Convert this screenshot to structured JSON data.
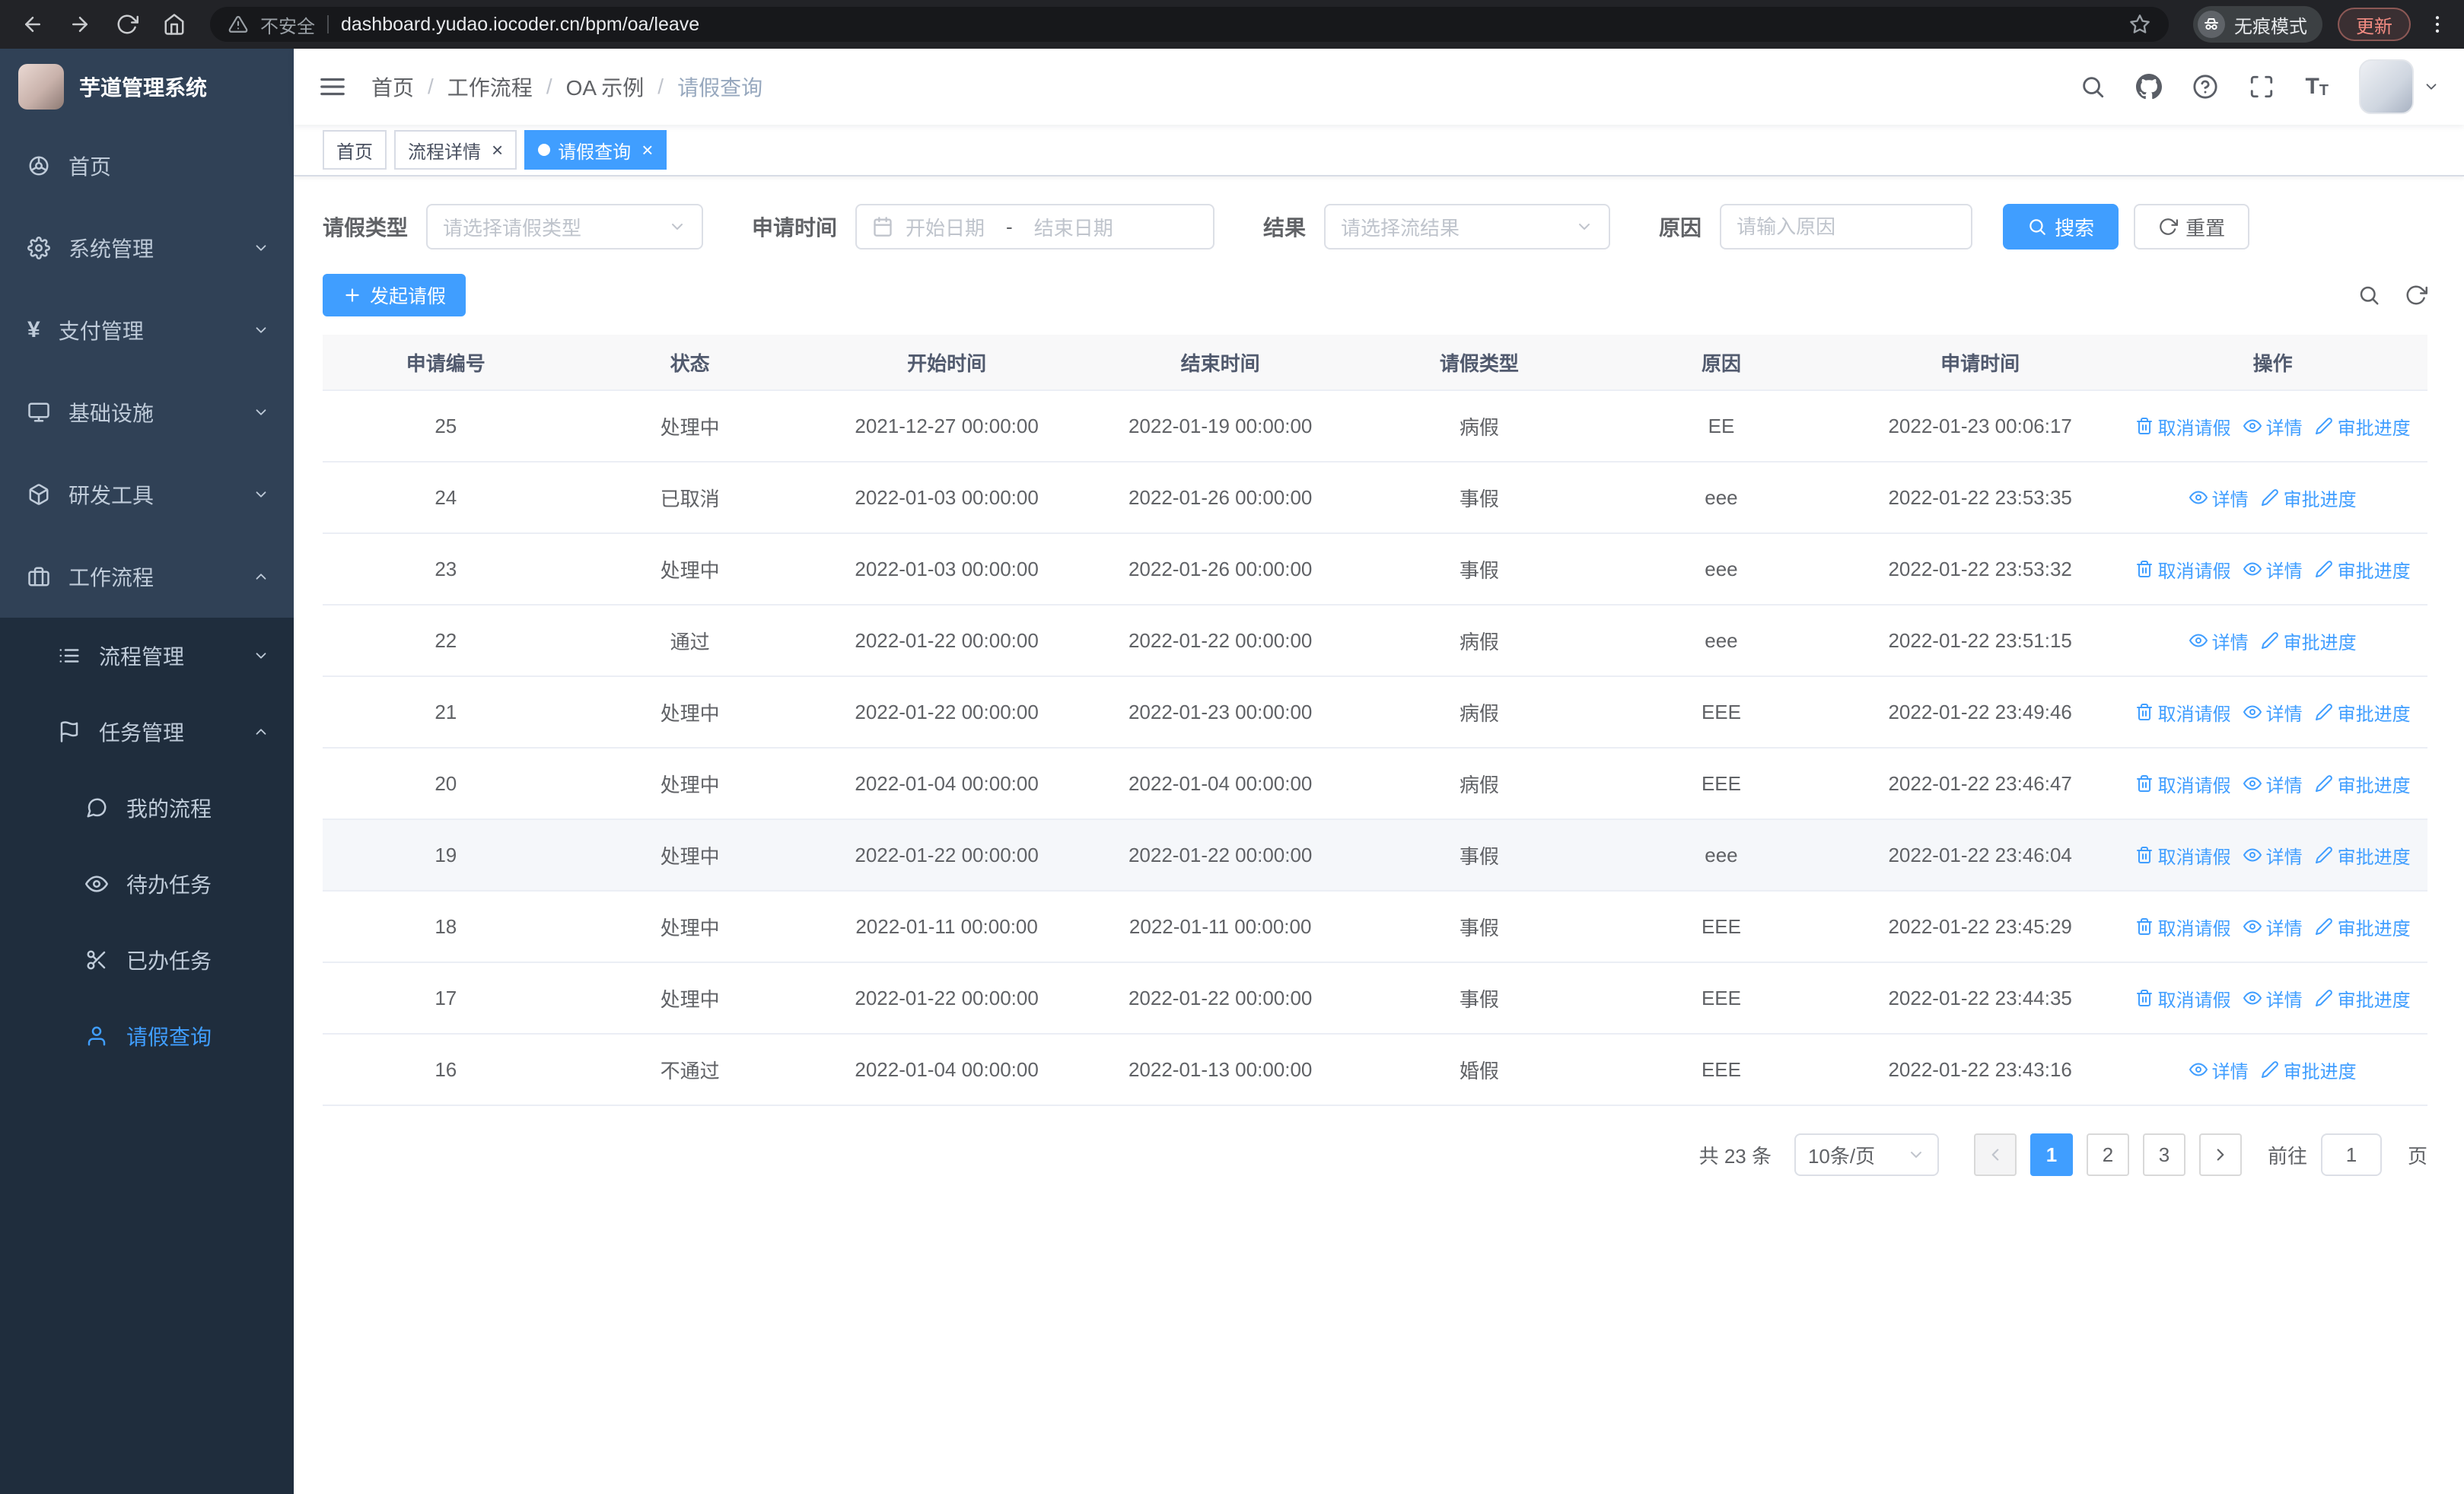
{
  "colors": {
    "primary": "#409eff",
    "sidebar_bg": "#304156",
    "submenu_bg": "#1f2d3d",
    "chrome_bg": "#222327",
    "update_badge": "#f28b82"
  },
  "browser": {
    "nav_icons": [
      "back-icon",
      "forward-icon",
      "refresh-icon",
      "home-icon"
    ],
    "security_label": "不安全",
    "url": "dashboard.yudao.iocoder.cn/bpm/oa/leave",
    "incognito_label": "无痕模式",
    "update_label": "更新"
  },
  "sidebar": {
    "logo_title": "芋道管理系统",
    "items": [
      {
        "name": "home",
        "label": "首页",
        "icon": "dashboard-icon",
        "level": 1,
        "expandable": false,
        "expanded": false,
        "active": false
      },
      {
        "name": "system-management",
        "label": "系统管理",
        "icon": "gear-icon",
        "level": 1,
        "expandable": true,
        "expanded": false,
        "active": false
      },
      {
        "name": "payment-management",
        "label": "支付管理",
        "icon": "yen-icon",
        "level": 1,
        "expandable": true,
        "expanded": false,
        "active": false
      },
      {
        "name": "infrastructure",
        "label": "基础设施",
        "icon": "monitor-icon",
        "level": 1,
        "expandable": true,
        "expanded": false,
        "active": false
      },
      {
        "name": "dev-tools",
        "label": "研发工具",
        "icon": "toolbox-icon",
        "level": 1,
        "expandable": true,
        "expanded": false,
        "active": false
      },
      {
        "name": "workflow",
        "label": "工作流程",
        "icon": "briefcase-icon",
        "level": 1,
        "expandable": true,
        "expanded": true,
        "active": false
      },
      {
        "name": "process-management",
        "label": "流程管理",
        "icon": "list-icon",
        "level": 2,
        "expandable": true,
        "expanded": false,
        "active": false
      },
      {
        "name": "task-management",
        "label": "任务管理",
        "icon": "flag-icon",
        "level": 2,
        "expandable": true,
        "expanded": true,
        "active": false
      },
      {
        "name": "my-process",
        "label": "我的流程",
        "icon": "chat-icon",
        "level": 3,
        "expandable": false,
        "expanded": false,
        "active": false
      },
      {
        "name": "todo-tasks",
        "label": "待办任务",
        "icon": "eye-icon",
        "level": 3,
        "expandable": false,
        "expanded": false,
        "active": false
      },
      {
        "name": "done-tasks",
        "label": "已办任务",
        "icon": "scissors-icon",
        "level": 3,
        "expandable": false,
        "expanded": false,
        "active": false
      },
      {
        "name": "leave-query",
        "label": "请假查询",
        "icon": "user-icon",
        "level": 3,
        "expandable": false,
        "expanded": false,
        "active": true
      }
    ]
  },
  "header": {
    "breadcrumb": [
      "首页",
      "工作流程",
      "OA 示例",
      "请假查询"
    ],
    "right_icons": [
      "search-icon",
      "github-icon",
      "help-icon",
      "fullscreen-icon",
      "font-size-icon"
    ]
  },
  "tabs": [
    {
      "name": "home",
      "label": "首页",
      "closable": false,
      "active": false
    },
    {
      "name": "process-detail",
      "label": "流程详情",
      "closable": true,
      "active": false
    },
    {
      "name": "leave-query",
      "label": "请假查询",
      "closable": true,
      "active": true
    }
  ],
  "filters": {
    "leave_type_label": "请假类型",
    "leave_type_placeholder": "请选择请假类型",
    "apply_time_label": "申请时间",
    "start_date_placeholder": "开始日期",
    "range_separator": "-",
    "end_date_placeholder": "结束日期",
    "result_label": "结果",
    "result_placeholder": "请选择流结果",
    "reason_label": "原因",
    "reason_placeholder": "请输入原因",
    "search_label": "搜索",
    "reset_label": "重置"
  },
  "toolbar": {
    "create_label": "发起请假"
  },
  "table": {
    "columns": [
      "申请编号",
      "状态",
      "开始时间",
      "结束时间",
      "请假类型",
      "原因",
      "申请时间",
      "操作"
    ],
    "action_defs": {
      "cancel": {
        "label": "取消请假",
        "icon": "delete-icon"
      },
      "detail": {
        "label": "详情",
        "icon": "eye-icon"
      },
      "progress": {
        "label": "审批进度",
        "icon": "edit-icon"
      }
    },
    "rows": [
      {
        "id": "25",
        "status": "处理中",
        "start": "2021-12-27 00:00:00",
        "end": "2022-01-19 00:00:00",
        "type": "病假",
        "reason": "EE",
        "applied": "2022-01-23 00:06:17",
        "actions": [
          "cancel",
          "detail",
          "progress"
        ],
        "highlighted": false
      },
      {
        "id": "24",
        "status": "已取消",
        "start": "2022-01-03 00:00:00",
        "end": "2022-01-26 00:00:00",
        "type": "事假",
        "reason": "eee",
        "applied": "2022-01-22 23:53:35",
        "actions": [
          "detail",
          "progress"
        ],
        "highlighted": false
      },
      {
        "id": "23",
        "status": "处理中",
        "start": "2022-01-03 00:00:00",
        "end": "2022-01-26 00:00:00",
        "type": "事假",
        "reason": "eee",
        "applied": "2022-01-22 23:53:32",
        "actions": [
          "cancel",
          "detail",
          "progress"
        ],
        "highlighted": false
      },
      {
        "id": "22",
        "status": "通过",
        "start": "2022-01-22 00:00:00",
        "end": "2022-01-22 00:00:00",
        "type": "病假",
        "reason": "eee",
        "applied": "2022-01-22 23:51:15",
        "actions": [
          "detail",
          "progress"
        ],
        "highlighted": false
      },
      {
        "id": "21",
        "status": "处理中",
        "start": "2022-01-22 00:00:00",
        "end": "2022-01-23 00:00:00",
        "type": "病假",
        "reason": "EEE",
        "applied": "2022-01-22 23:49:46",
        "actions": [
          "cancel",
          "detail",
          "progress"
        ],
        "highlighted": false
      },
      {
        "id": "20",
        "status": "处理中",
        "start": "2022-01-04 00:00:00",
        "end": "2022-01-04 00:00:00",
        "type": "病假",
        "reason": "EEE",
        "applied": "2022-01-22 23:46:47",
        "actions": [
          "cancel",
          "detail",
          "progress"
        ],
        "highlighted": false
      },
      {
        "id": "19",
        "status": "处理中",
        "start": "2022-01-22 00:00:00",
        "end": "2022-01-22 00:00:00",
        "type": "事假",
        "reason": "eee",
        "applied": "2022-01-22 23:46:04",
        "actions": [
          "cancel",
          "detail",
          "progress"
        ],
        "highlighted": true
      },
      {
        "id": "18",
        "status": "处理中",
        "start": "2022-01-11 00:00:00",
        "end": "2022-01-11 00:00:00",
        "type": "事假",
        "reason": "EEE",
        "applied": "2022-01-22 23:45:29",
        "actions": [
          "cancel",
          "detail",
          "progress"
        ],
        "highlighted": false
      },
      {
        "id": "17",
        "status": "处理中",
        "start": "2022-01-22 00:00:00",
        "end": "2022-01-22 00:00:00",
        "type": "事假",
        "reason": "EEE",
        "applied": "2022-01-22 23:44:35",
        "actions": [
          "cancel",
          "detail",
          "progress"
        ],
        "highlighted": false
      },
      {
        "id": "16",
        "status": "不通过",
        "start": "2022-01-04 00:00:00",
        "end": "2022-01-13 00:00:00",
        "type": "婚假",
        "reason": "EEE",
        "applied": "2022-01-22 23:43:16",
        "actions": [
          "detail",
          "progress"
        ],
        "highlighted": false
      }
    ]
  },
  "pagination": {
    "total_text": "共 23 条",
    "page_size": "10条/页",
    "pages": [
      "1",
      "2",
      "3"
    ],
    "active_page": "1",
    "goto_prefix": "前往",
    "goto_value": "1",
    "goto_suffix": "页"
  }
}
